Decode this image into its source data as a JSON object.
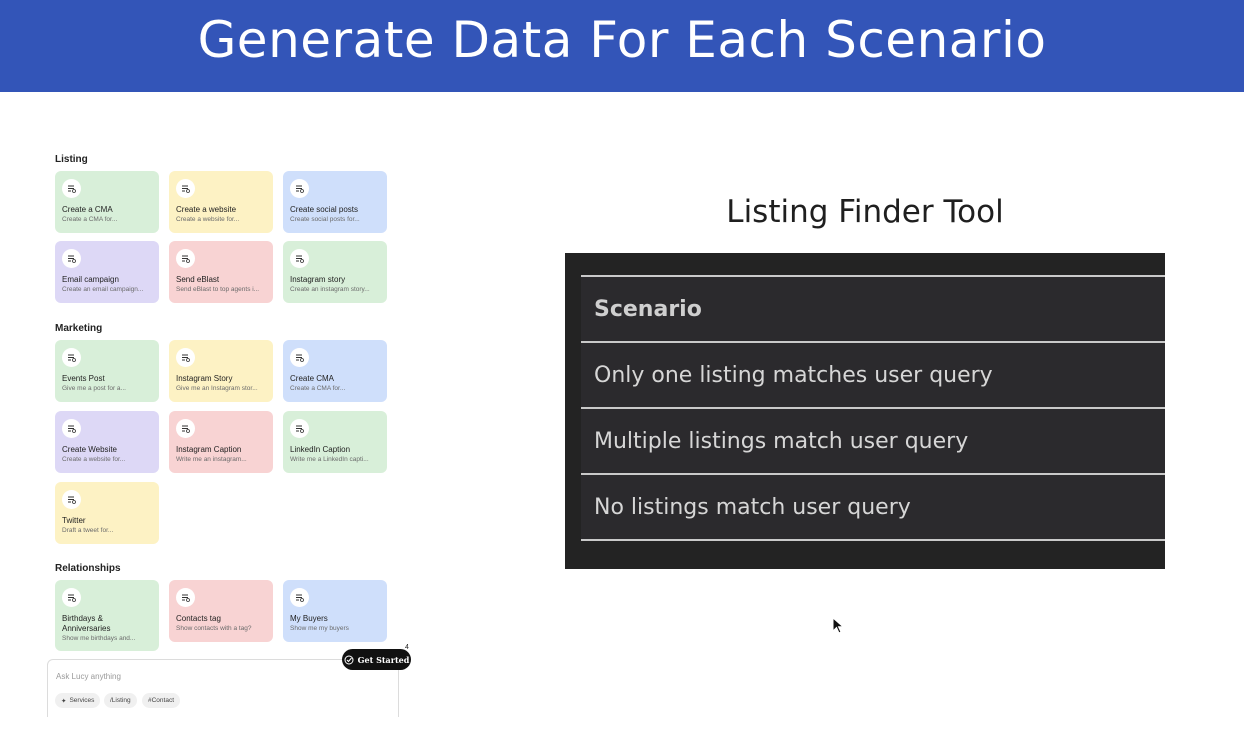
{
  "banner": {
    "title": "Generate Data For Each Scenario"
  },
  "sections": {
    "listing": "Listing",
    "marketing": "Marketing",
    "relationships": "Relationships"
  },
  "cards": [
    {
      "title": "Create a CMA",
      "sub": "Create a CMA for..."
    },
    {
      "title": "Create a website",
      "sub": "Create a website for..."
    },
    {
      "title": "Create social posts",
      "sub": "Create social posts for..."
    },
    {
      "title": "Email campaign",
      "sub": "Create an email campaign..."
    },
    {
      "title": "Send eBlast",
      "sub": "Send eBlast to top agents i..."
    },
    {
      "title": "Instagram story",
      "sub": "Create an instagram story..."
    },
    {
      "title": "Events Post",
      "sub": "Give me a post for a..."
    },
    {
      "title": "Instagram Story",
      "sub": "Give me an Instagram stor..."
    },
    {
      "title": "Create CMA",
      "sub": "Create a CMA for..."
    },
    {
      "title": "Create Website",
      "sub": "Create a website for..."
    },
    {
      "title": "Instagram Caption",
      "sub": "Write me an instagram..."
    },
    {
      "title": "LinkedIn Caption",
      "sub": "Write me a LinkedIn capti..."
    },
    {
      "title": "Twitter",
      "sub": "Draft a tweet for..."
    },
    {
      "title": "Birthdays &",
      "title2": "Anniversaries",
      "sub": "Show me birthdays and..."
    },
    {
      "title": "Contacts tag",
      "sub": "Show contacts with a tag?"
    },
    {
      "title": "My Buyers",
      "sub": "Show me my buyers"
    }
  ],
  "ask": {
    "placeholder": "Ask Lucy anything",
    "chips": [
      "Services",
      "/Listing",
      "#Contact"
    ]
  },
  "get_started": {
    "label": "Get Started",
    "badge": "4"
  },
  "tool": {
    "title": "Listing Finder Tool",
    "header": "Scenario",
    "rows": [
      "Only one listing matches user query",
      "Multiple listings match user query",
      "No listings match user query"
    ]
  },
  "colors": {
    "banner": "#3355b8",
    "card_green": "#d8efd9",
    "card_yellow": "#fdf2c4",
    "card_blue": "#cfdffb",
    "card_purple": "#ddd8f6",
    "card_pink": "#f8d3d3",
    "panel": "#232323"
  }
}
